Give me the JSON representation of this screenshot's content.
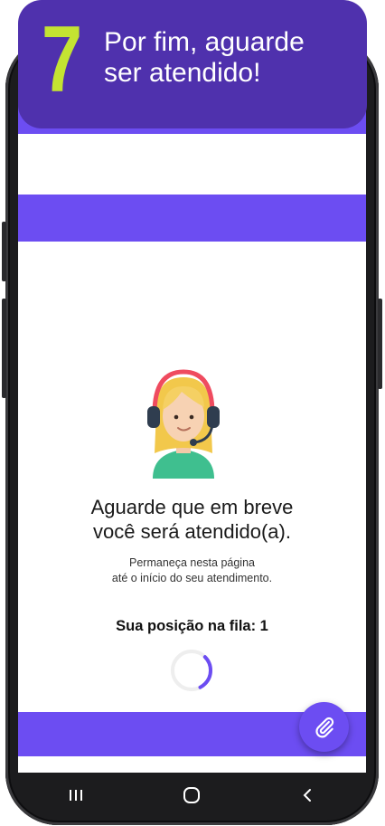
{
  "banner": {
    "step": "7",
    "line1": "Por fim, aguarde",
    "line2": "ser atendido!"
  },
  "main": {
    "headline_line1": "Aguarde que em breve",
    "headline_line2": "você será atendido(a).",
    "sub_line1": "Permaneça nesta página",
    "sub_line2": "até o início do seu atendimento.",
    "queue_label": "Sua posição na fila: 1",
    "spinner_progress": 0.3
  },
  "icons": {
    "avatar": "support-agent-icon",
    "fab": "paperclip-icon",
    "nav_recents": "recents-icon",
    "nav_home": "home-icon",
    "nav_back": "back-icon"
  },
  "colors": {
    "accent": "#6c4df2",
    "banner": "#4f31ad",
    "step_number": "#c4e332"
  }
}
